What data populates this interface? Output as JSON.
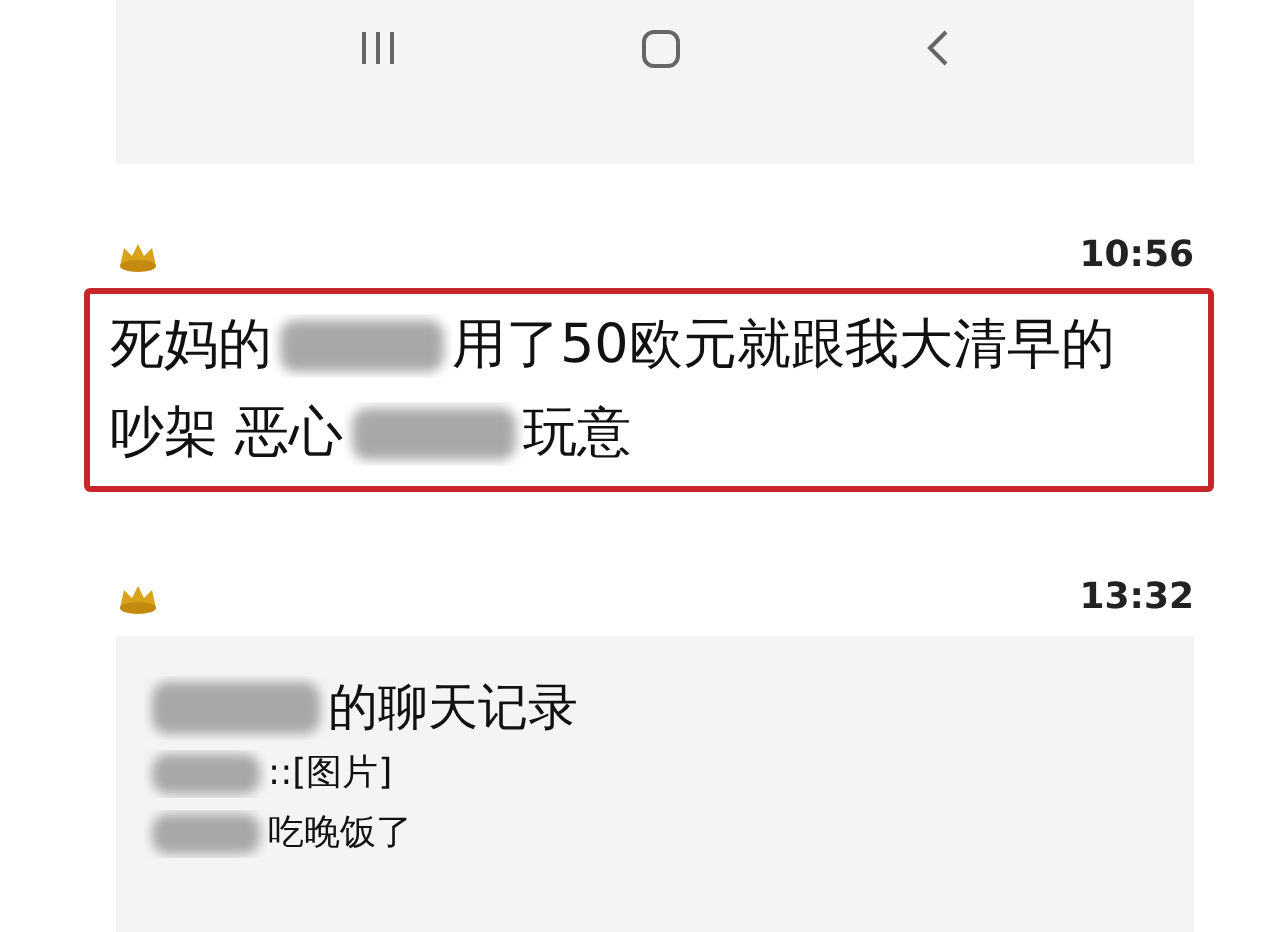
{
  "nav_bar": {
    "buttons": [
      {
        "kind": "recents"
      },
      {
        "kind": "home"
      },
      {
        "kind": "back"
      }
    ]
  },
  "messages": [
    {
      "time": "10:56",
      "highlighted": true,
      "kind": "text",
      "lines": [
        [
          {
            "kind": "text",
            "text": "死妈的"
          },
          {
            "kind": "redacted"
          },
          {
            "kind": "text",
            "text": "用了50欧元就跟我大清早的"
          }
        ],
        [
          {
            "kind": "text",
            "text": "吵架 恶心"
          },
          {
            "kind": "redacted"
          },
          {
            "kind": "text",
            "text": "玩意"
          }
        ]
      ]
    },
    {
      "time": "13:32",
      "highlighted": false,
      "kind": "chat_record",
      "title": [
        {
          "kind": "redacted"
        },
        {
          "kind": "text",
          "text": "的聊天记录"
        }
      ],
      "lines": [
        [
          {
            "kind": "redacted"
          },
          {
            "kind": "text",
            "text": "::[图片]"
          }
        ],
        [
          {
            "kind": "redacted"
          },
          {
            "kind": "text",
            "text": "吃晚饭了"
          }
        ]
      ]
    }
  ]
}
